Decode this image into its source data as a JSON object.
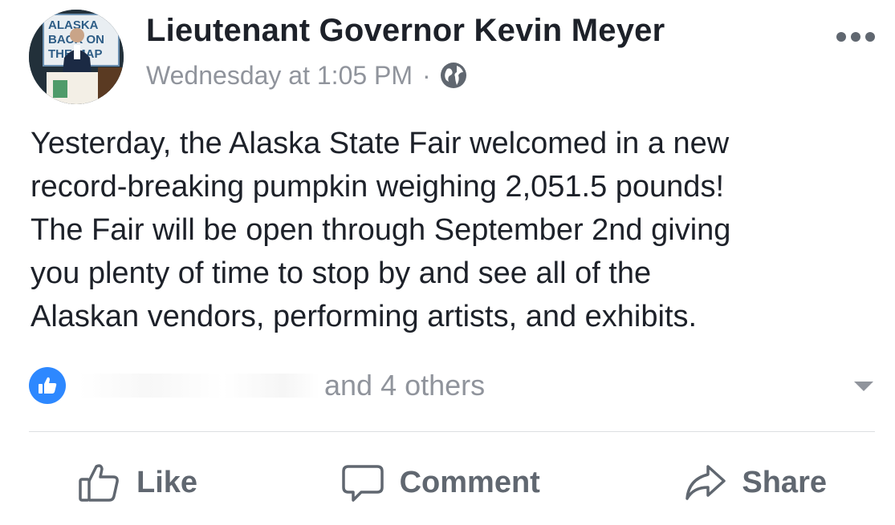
{
  "post": {
    "author": "Lieutenant Governor Kevin Meyer",
    "timestamp": "Wednesday at 1:05 PM",
    "separator": "·",
    "privacy_icon": "globe-icon",
    "more_icon": "more-options-icon",
    "body_lines": [
      "Yesterday, the Alaska State Fair welcomed in a new",
      "record-breaking pumpkin weighing 2,051.5 pounds!",
      "The Fair will be open through September 2nd giving",
      "you plenty of time to stop by and see all of the",
      "Alaskan vendors, performing artists, and exhibits."
    ],
    "avatar": {
      "sign_text": [
        "ALASKA",
        "BACK ON",
        "THE MAP"
      ]
    }
  },
  "reactions": {
    "icon": "like-reaction-icon",
    "others_text": "and 4 others"
  },
  "actions": {
    "like_label": "Like",
    "comment_label": "Comment",
    "share_label": "Share"
  },
  "colors": {
    "text_primary": "#1d2129",
    "text_secondary": "#90949c",
    "action_text": "#606770",
    "like_blue": "#2d88ff",
    "divider": "#dddfe2"
  }
}
